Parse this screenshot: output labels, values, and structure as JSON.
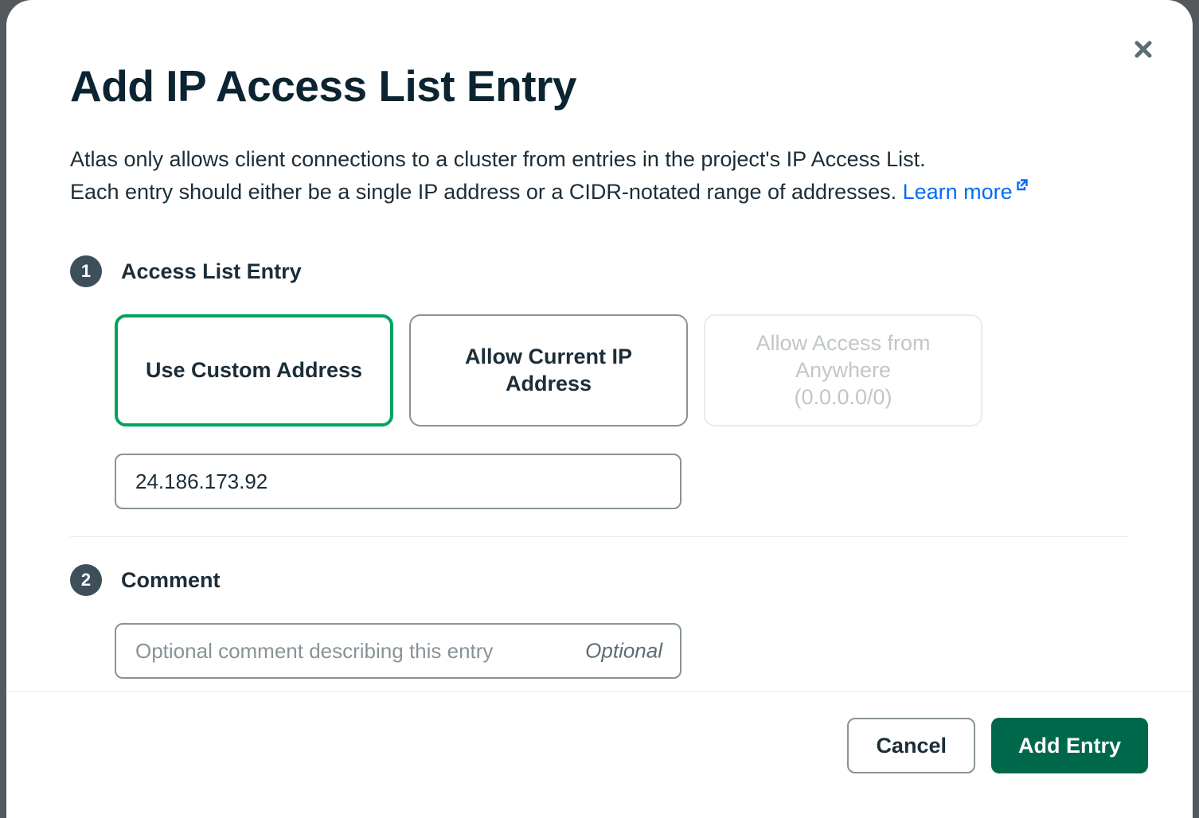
{
  "modal": {
    "title": "Add IP Access List Entry",
    "description_line1": "Atlas only allows client connections to a cluster from entries in the project's IP Access List.",
    "description_line2_prefix": "Each entry should either be a single IP address or a CIDR-notated range of addresses. ",
    "learn_more": "Learn more"
  },
  "step1": {
    "number": "1",
    "title": "Access List Entry",
    "options": {
      "custom": "Use Custom Address",
      "current": "Allow Current IP Address",
      "anywhere_line1": "Allow Access from Anywhere",
      "anywhere_line2": "(0.0.0.0/0)"
    },
    "ip_value": "24.186.173.92"
  },
  "step2": {
    "number": "2",
    "title": "Comment",
    "placeholder": "Optional comment describing this entry",
    "optional_tag": "Optional"
  },
  "footer": {
    "cancel": "Cancel",
    "add": "Add Entry"
  }
}
